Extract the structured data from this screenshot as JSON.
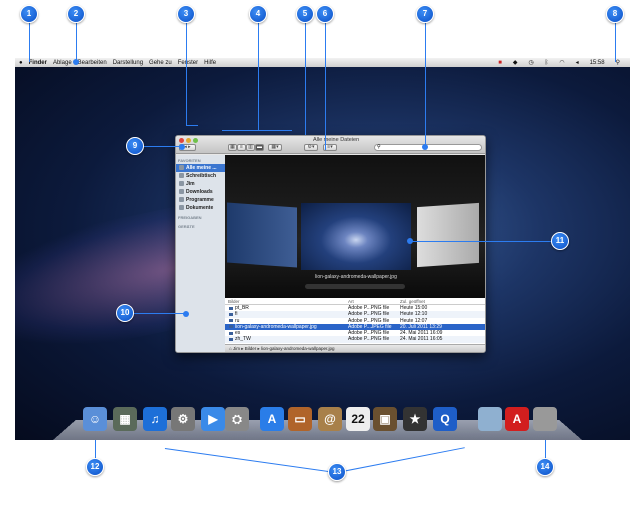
{
  "menubar": {
    "apple": "",
    "items": [
      "Finder",
      "Ablage",
      "Bearbeiten",
      "Darstellung",
      "Gehe zu",
      "Fenster",
      "Hilfe"
    ],
    "clock": "15:58",
    "status_icons": [
      "adobe-icon",
      "dropbox-icon",
      "time-machine-icon",
      "bluetooth-icon",
      "wifi-icon",
      "volume-icon"
    ]
  },
  "window": {
    "title": "Alle meine Dateien",
    "search_placeholder": "",
    "sidebar": {
      "favorites_header": "FAVORITEN",
      "items": [
        "Alle meine ...",
        "Schreibtisch",
        "Jim",
        "Downloads",
        "Programme",
        "Dokumente"
      ],
      "shared_header": "FREIGABEN",
      "devices_header": "GERÄTE"
    },
    "coverflow_caption": "lion-galaxy-andromeda-wallpaper.jpg",
    "columns": [
      "Bilder",
      "Art",
      "Zul. geöffnet"
    ],
    "rows": [
      {
        "name": "pt_BR",
        "kind": "Adobe P...PNG file",
        "date": "Heute 15:00"
      },
      {
        "name": "fi",
        "kind": "Adobe P...PNG file",
        "date": "Heute 12:10"
      },
      {
        "name": "ru",
        "kind": "Adobe P...PNG file",
        "date": "Heute 12:07"
      },
      {
        "name": "lion-galaxy-andromeda-wallpaper.jpg",
        "kind": "Adobe P...JPEG file",
        "date": "20. Juli 2011 13:29",
        "selected": true
      },
      {
        "name": "es",
        "kind": "Adobe P...PNG file",
        "date": "24. Mai 2011 16:09"
      },
      {
        "name": "zh_TW",
        "kind": "Adobe P...PNG file",
        "date": "24. Mai 2011 16:05"
      }
    ],
    "path": [
      "Jim",
      "Bilder",
      "lion-galaxy-andromeda-wallpaper.jpg"
    ]
  },
  "dock": [
    {
      "name": "finder",
      "glyph": "☺",
      "color": "#5a8fd8"
    },
    {
      "name": "image-capture",
      "glyph": "▦",
      "color": "#5a6a5a"
    },
    {
      "name": "itunes",
      "glyph": "♫",
      "color": "#1d6fd8"
    },
    {
      "name": "system-preferences",
      "glyph": "⚙",
      "color": "#777"
    },
    {
      "name": "facetime",
      "glyph": "▶",
      "color": "#3a8ae8"
    },
    {
      "name": "disk-utility",
      "glyph": "⛭",
      "color": "#888"
    },
    {
      "name": "app-store",
      "glyph": "A",
      "color": "#2a7de8"
    },
    {
      "name": "keynote",
      "glyph": "▭",
      "color": "#b0642a"
    },
    {
      "name": "address-book",
      "glyph": "@",
      "color": "#a8804a"
    },
    {
      "name": "ical",
      "glyph": "22",
      "color": "#eee"
    },
    {
      "name": "iphoto",
      "glyph": "▣",
      "color": "#6a5030"
    },
    {
      "name": "imovie",
      "glyph": "★",
      "color": "#333"
    },
    {
      "name": "quicktime",
      "glyph": "Q",
      "color": "#1e5ec8"
    },
    {
      "name": "folder",
      "glyph": "",
      "color": "#8fb0d0"
    },
    {
      "name": "adobe",
      "glyph": "A",
      "color": "#d21e1e"
    },
    {
      "name": "trash",
      "glyph": "",
      "color": "#999"
    }
  ],
  "callouts": [
    "1",
    "2",
    "3",
    "4",
    "5",
    "6",
    "7",
    "8",
    "9",
    "10",
    "11",
    "12",
    "13",
    "14"
  ]
}
